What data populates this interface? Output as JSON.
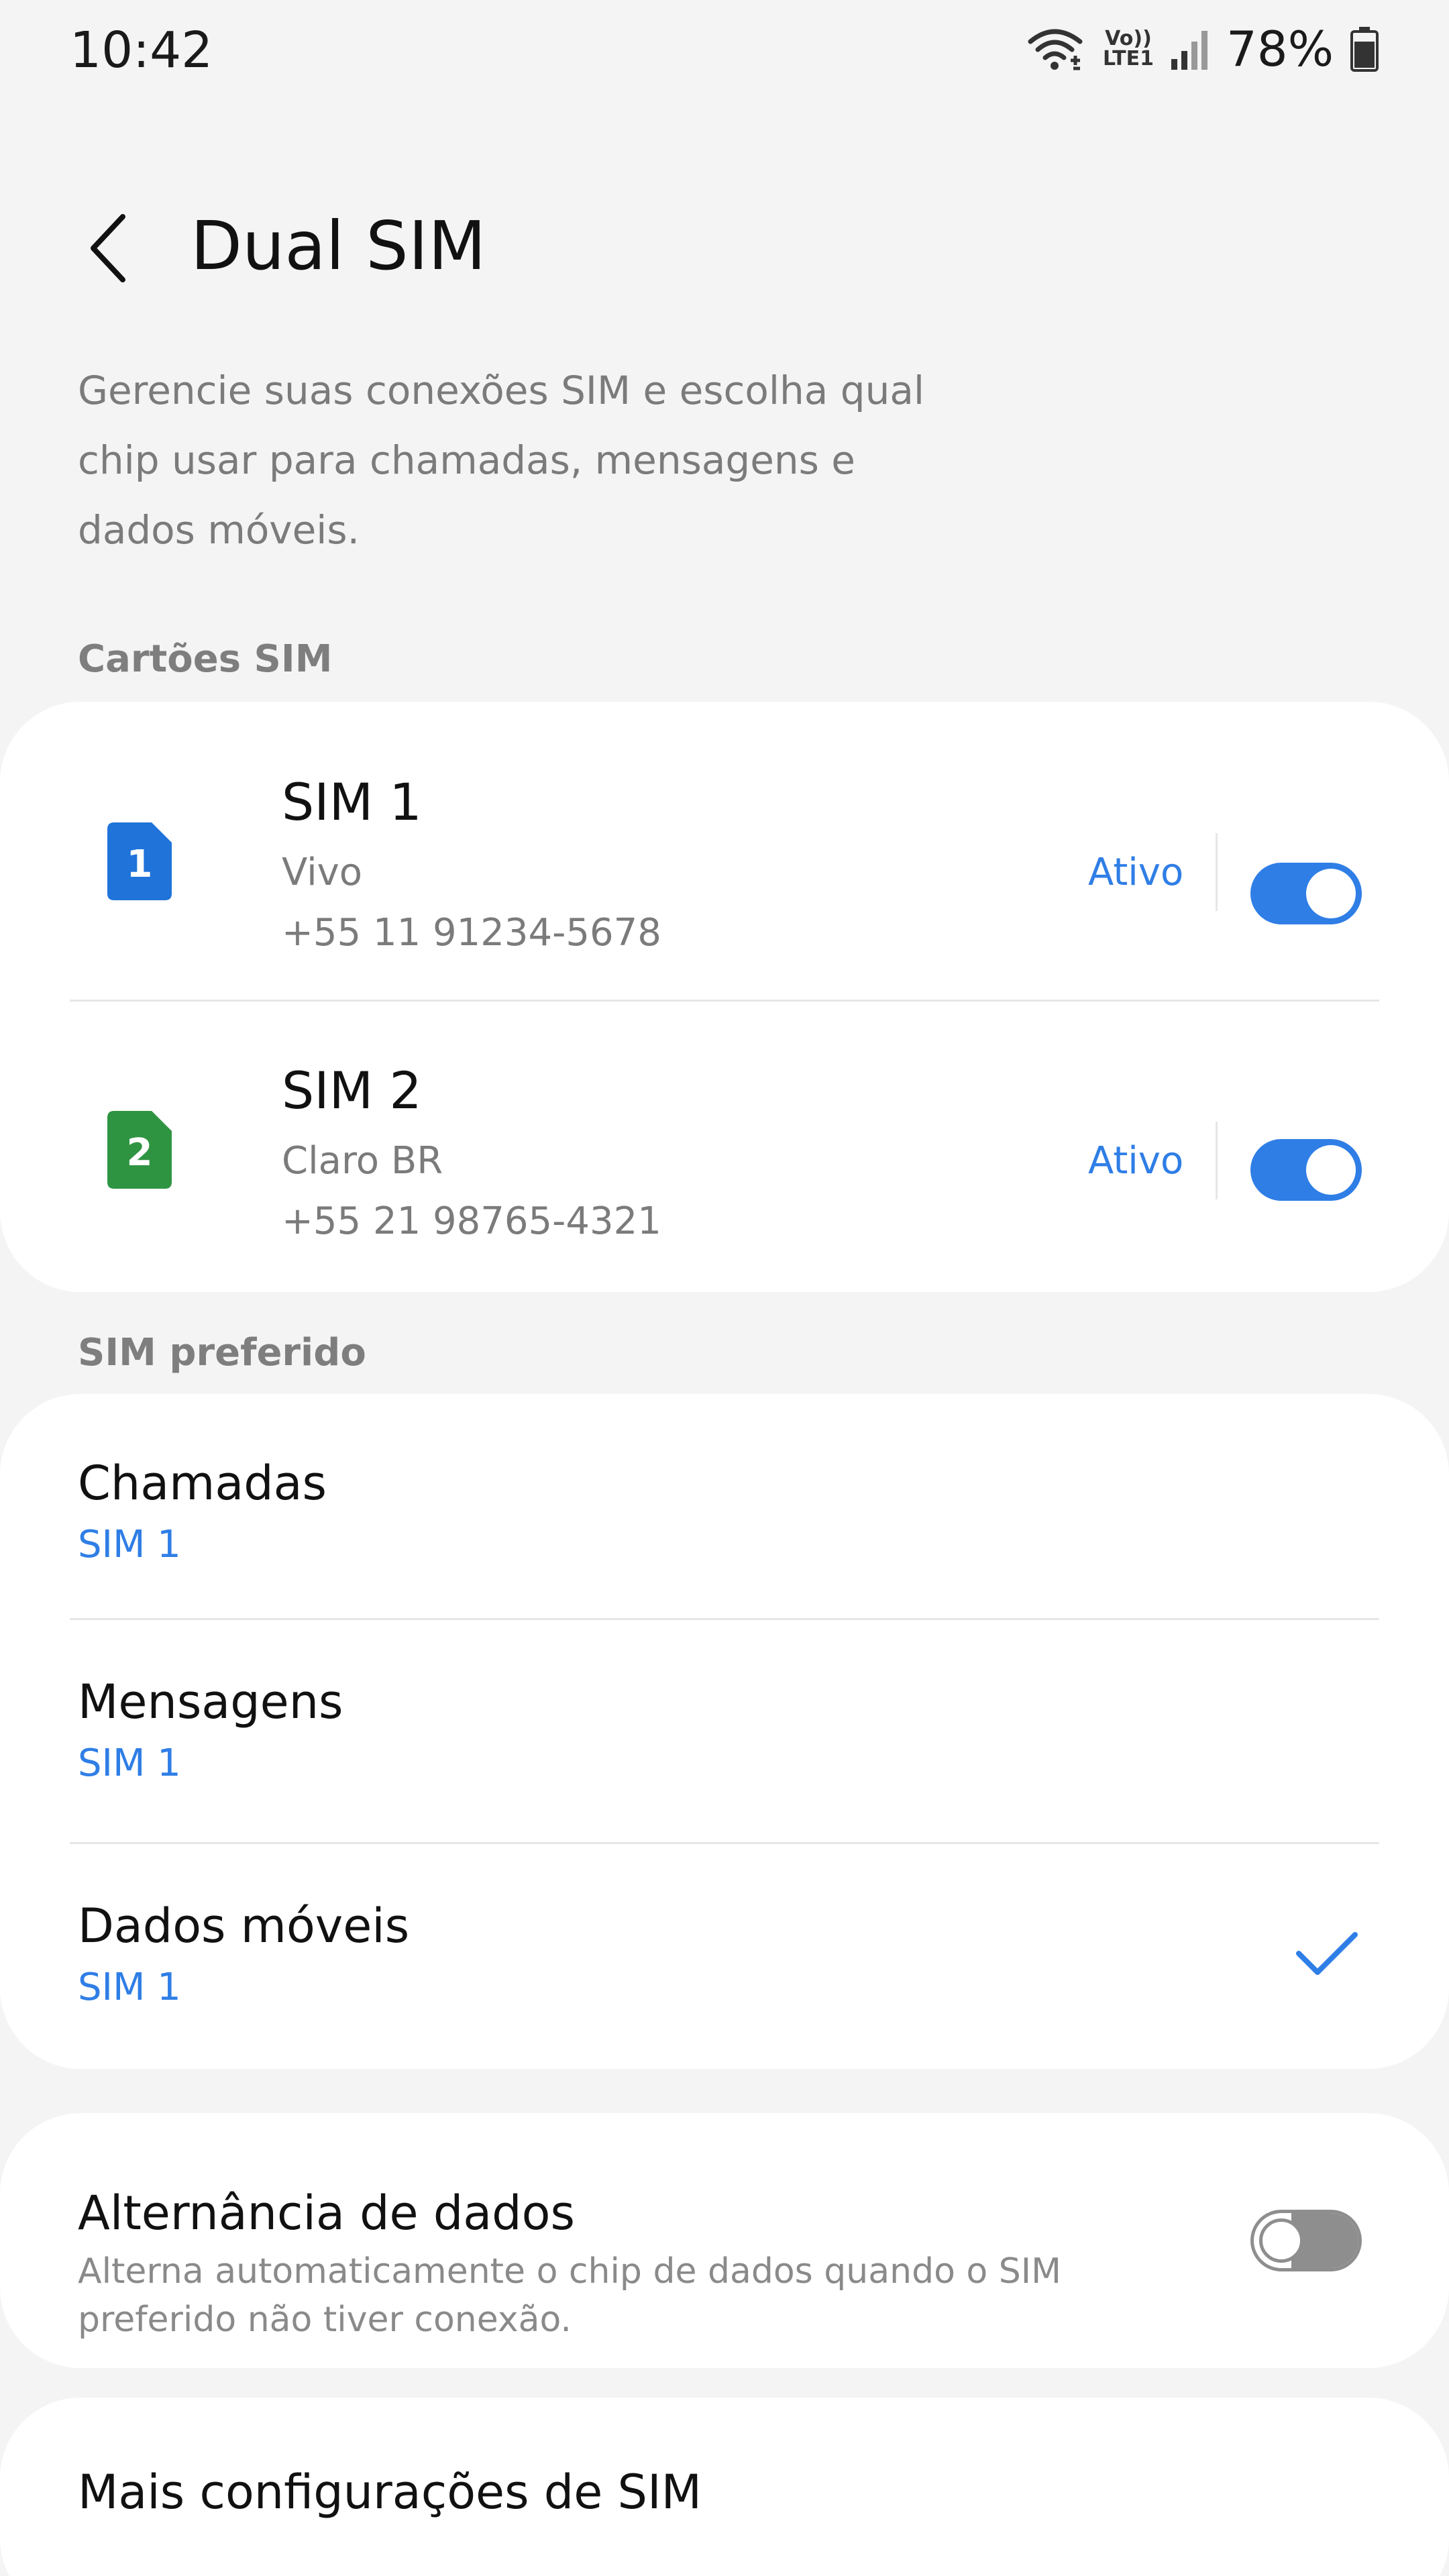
{
  "status_bar": {
    "time": "10:42",
    "volte_top": "Vo))",
    "volte_bottom": "LTE1",
    "battery_percent": "78%",
    "icons": [
      "wifi-icon",
      "volte-icon",
      "signal-icon",
      "battery-icon"
    ]
  },
  "header": {
    "title": "Dual SIM",
    "description": "Gerencie suas conexões SIM e escolha qual chip usar para chamadas, mensagens e dados móveis."
  },
  "sim_cards": {
    "section_label": "Cartões SIM",
    "items": [
      {
        "badge": "1",
        "badge_color": "#1f73d9",
        "name": "SIM 1",
        "carrier": "Vivo",
        "number": "+55 11 91234-5678",
        "status": "Ativo",
        "enabled": true
      },
      {
        "badge": "2",
        "badge_color": "#2f9442",
        "name": "SIM 2",
        "carrier": "Claro BR",
        "number": "+55 21 98765-4321",
        "status": "Ativo",
        "enabled": true
      }
    ]
  },
  "preferred_sim": {
    "section_label": "SIM preferido",
    "items": [
      {
        "title": "Chamadas",
        "value": "SIM 1",
        "checked": false
      },
      {
        "title": "Mensagens",
        "value": "SIM 1",
        "checked": false
      },
      {
        "title": "Dados móveis",
        "value": "SIM 1",
        "checked": true
      }
    ]
  },
  "data_switching": {
    "title": "Alternância de dados",
    "description": "Alterna automaticamente o chip de dados quando o SIM preferido não tiver conexão.",
    "enabled": false
  },
  "more_settings": {
    "title": "Mais configurações de SIM"
  },
  "colors": {
    "accent": "#2f7ee6",
    "background": "#f4f4f4",
    "card": "#ffffff",
    "secondary_text": "#7b7b7b"
  }
}
